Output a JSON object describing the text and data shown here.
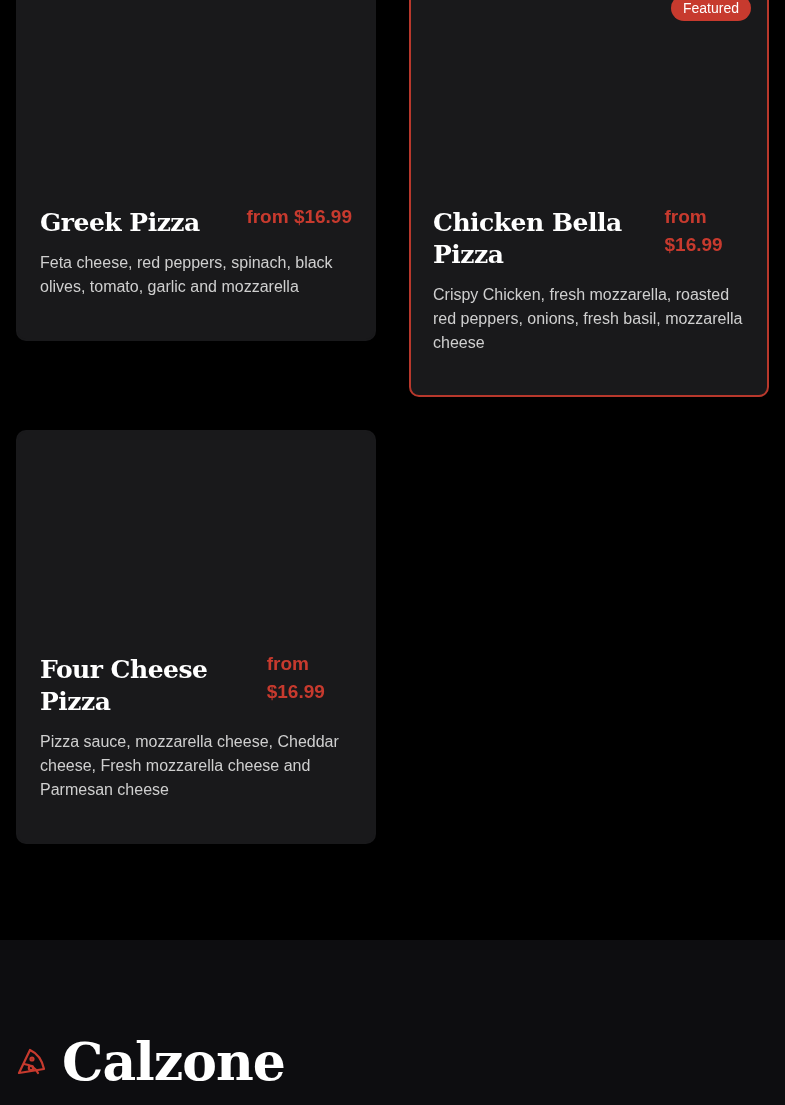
{
  "items": [
    {
      "name": "Greek Pizza",
      "price": "from $16.99",
      "description": "Feta cheese, red peppers, spinach, black olives, tomato, garlic and mozzarella",
      "featured": false
    },
    {
      "name": "Chicken Bella Pizza",
      "price": "from $16.99",
      "description": "Crispy Chicken, fresh mozzarella, roasted red peppers, onions, fresh basil, mozzarella cheese",
      "featured": true,
      "badge": "Featured"
    },
    {
      "name": "Four Cheese Pizza",
      "price": "from $16.99",
      "description": "Pizza sauce, mozzarella cheese, Cheddar cheese, Fresh mozzarella cheese and Parmesan cheese",
      "featured": false
    }
  ],
  "next_section": {
    "title": "Calzone"
  }
}
